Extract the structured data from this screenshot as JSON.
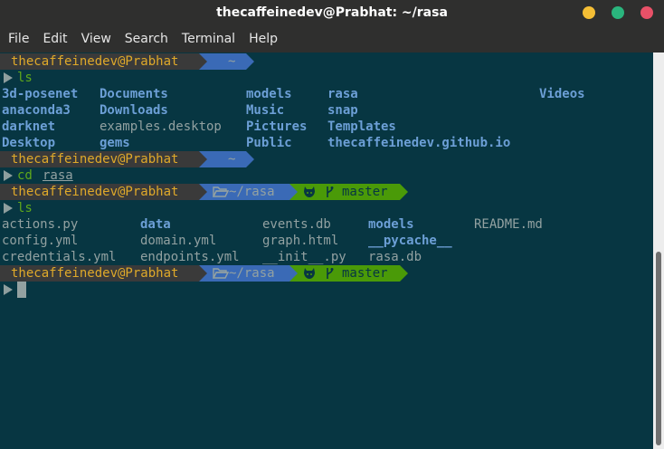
{
  "window": {
    "title": "thecaffeinedev@Prabhat: ~/rasa",
    "colors": {
      "minimize": "#f4be35",
      "maximize": "#2ab57d",
      "close": "#e95168"
    }
  },
  "menu": [
    "File",
    "Edit",
    "View",
    "Search",
    "Terminal",
    "Help"
  ],
  "prompt": {
    "user": "thecaffeinedev@Prabhat",
    "home_dir": "~",
    "rasa_dir": "~/rasa",
    "git_branch": "master",
    "icons": [
      "folder-open-icon",
      "github-icon",
      "git-branch-icon"
    ]
  },
  "commands": {
    "ls1": "ls",
    "cd": "cd",
    "cd_arg": "rasa",
    "ls2": "ls"
  },
  "home_listing": [
    [
      "3d-posenet",
      "Documents",
      "models",
      "rasa",
      "Videos"
    ],
    [
      "anaconda3",
      "Downloads",
      "Music",
      "snap"
    ],
    [
      "darknet",
      "examples.desktop",
      "Pictures",
      "Templates"
    ],
    [
      "Desktop",
      "gems",
      "Public",
      "thecaffeinedev.github.io"
    ]
  ],
  "rasa_listing": [
    [
      "actions.py",
      "data",
      "events.db",
      "models",
      "README.md"
    ],
    [
      "config.yml",
      "domain.yml",
      "graph.html",
      "__pycache__"
    ],
    [
      "credentials.yml",
      "endpoints.yml",
      "__init__.py",
      "rasa.db"
    ]
  ],
  "colors": {
    "background": "#073642",
    "user_fg": "#dfa92a",
    "path_bg": "#3a6ab6",
    "git_bg": "#4a9a08",
    "command": "#5fa81a",
    "directory": "#6c9fd6",
    "file": "#92a1a1"
  }
}
